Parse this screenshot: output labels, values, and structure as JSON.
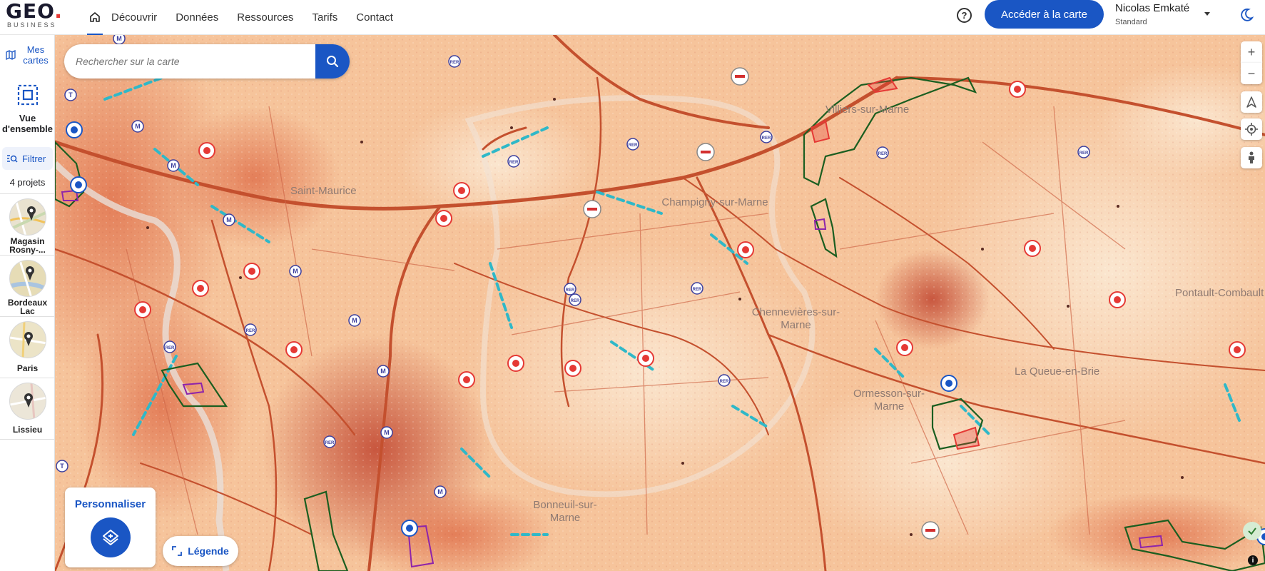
{
  "header": {
    "logo_text": "GEO",
    "logo_subtitle": "BUSINESS",
    "nav": [
      "Découvrir",
      "Données",
      "Ressources",
      "Tarifs",
      "Contact"
    ],
    "help_glyph": "?",
    "cta_label": "Accéder à la carte",
    "user_name": "Nicolas Emkaté",
    "user_plan": "Standard"
  },
  "sidebar": {
    "my_maps": "Mes cartes",
    "overview": "Vue d'ensemble",
    "filter": "Filtrer",
    "project_count": "4 projets",
    "projects": [
      {
        "name": "Magasin Rosny-..."
      },
      {
        "name": "Bordeaux Lac"
      },
      {
        "name": "Paris"
      },
      {
        "name": "Lissieu"
      }
    ]
  },
  "search": {
    "placeholder": "Rechercher sur la carte"
  },
  "map": {
    "labels": [
      "Saint-Maurice",
      "Champigny-sur-Marne",
      "Villiers-sur-Marne",
      "Chennevières-sur-Marne",
      "Ormesson-sur-Marne",
      "La Queue-en-Brie",
      "Pontault-Combault",
      "Bonneuil-sur-Marne"
    ],
    "heat_colors": [
      "#fbe3c6",
      "#f6c49b",
      "#ee9d70",
      "#df6d48",
      "#c0432e"
    ],
    "road_color": "#c4502e",
    "zone_color": "#1b5e20",
    "rer_badge": "RER",
    "metro_badge": "M",
    "tram_badge": "T"
  },
  "controls": {
    "zoom_in": "+",
    "zoom_out": "−"
  },
  "customize": {
    "label": "Personnaliser"
  },
  "legend": {
    "label": "Légende"
  },
  "colors": {
    "primary": "#1a56c4",
    "accent_red": "#e53935"
  }
}
